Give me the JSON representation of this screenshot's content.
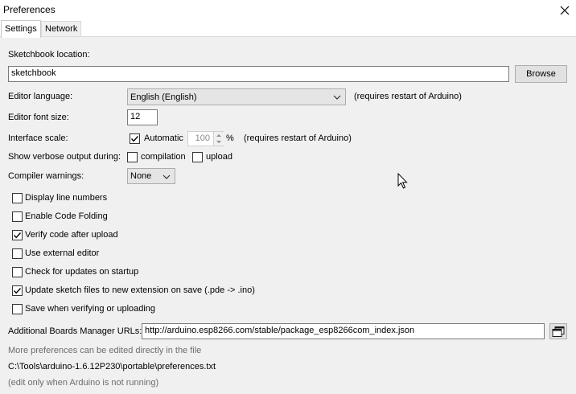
{
  "window": {
    "title": "Preferences"
  },
  "tabs": [
    {
      "label": "Settings",
      "active": true
    },
    {
      "label": "Network",
      "active": false
    }
  ],
  "settings": {
    "sketchbook_label": "Sketchbook location:",
    "sketchbook_value": "sketchbook",
    "browse_label": "Browse",
    "language_label": "Editor language:",
    "language_value": "English (English)",
    "language_note": "(requires restart of Arduino)",
    "font_size_label": "Editor font size:",
    "font_size_value": "12",
    "scale_label": "Interface scale:",
    "scale_auto_label": "Automatic",
    "scale_auto_checked": true,
    "scale_value": "100",
    "scale_unit": "%",
    "scale_note": "(requires restart of Arduino)",
    "verbose_label": "Show verbose output during:",
    "verbose_compilation_label": "compilation",
    "verbose_compilation_checked": false,
    "verbose_upload_label": "upload",
    "verbose_upload_checked": false,
    "warnings_label": "Compiler warnings:",
    "warnings_value": "None",
    "options": [
      {
        "label": "Display line numbers",
        "checked": false
      },
      {
        "label": "Enable Code Folding",
        "checked": false
      },
      {
        "label": "Verify code after upload",
        "checked": true
      },
      {
        "label": "Use external editor",
        "checked": false
      },
      {
        "label": "Check for updates on startup",
        "checked": false
      },
      {
        "label": "Update sketch files to new extension on save (.pde -> .ino)",
        "checked": true
      },
      {
        "label": "Save when verifying or uploading",
        "checked": false
      }
    ],
    "boards_url_label": "Additional Boards Manager URLs:",
    "boards_url_value": "http://arduino.esp8266.com/stable/package_esp8266com_index.json",
    "more_prefs_note": "More preferences can be edited directly in the file",
    "prefs_path": "C:\\Tools\\arduino-1.6.12P230\\portable\\preferences.txt",
    "edit_note": "(edit only when Arduino is not running)"
  },
  "icons": {
    "close": "close-icon",
    "chevron": "chevron-down-icon",
    "check": "checkmark-icon",
    "url_editor": "open-window-icon",
    "cursor": "mouse-pointer-icon"
  }
}
